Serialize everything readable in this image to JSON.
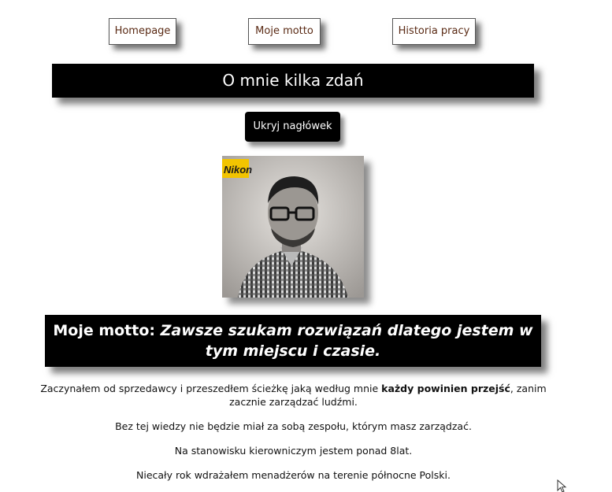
{
  "nav": {
    "homepage": "Homepage",
    "motto": "Moje motto",
    "history": "Historia pracy"
  },
  "header": {
    "title": "O mnie kilka zdań"
  },
  "toggle_button": {
    "label": "Ukryj nagłówek"
  },
  "photo": {
    "brand_text": "Nikon"
  },
  "motto": {
    "prefix": "Moje motto: ",
    "text": "Zawsze szukam rozwiązań dlatego jestem w tym miejscu i czasie."
  },
  "paragraphs": {
    "p1_before": "Zaczynałem od sprzedawcy i przeszedłem ścieżkę jaką według mnie ",
    "p1_bold": "każdy powinien przejść",
    "p1_after": ", zanim zacznie zarządzać ludźmi.",
    "p2": "Bez tej wiedzy nie będzie miał za sobą zespołu, którym masz zarządzać.",
    "p3": "Na stanowisku kierowniczym jestem ponad 8lat.",
    "p4": "Niecały rok wdrażałem menadżerów na terenie północne Polski."
  },
  "colors": {
    "nav_text": "#5a2a14",
    "bar_bg": "#000000",
    "bar_text": "#ffffff"
  }
}
